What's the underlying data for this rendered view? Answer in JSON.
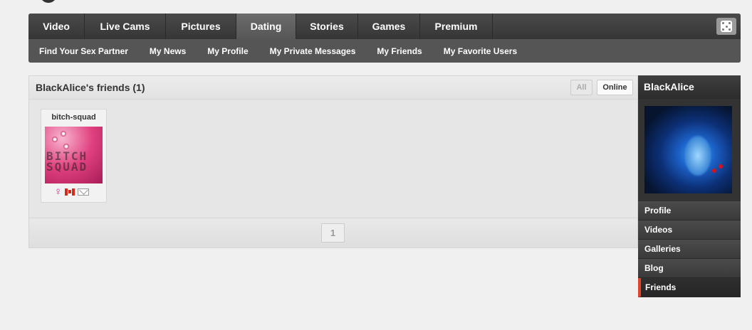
{
  "nav": {
    "tabs": [
      {
        "label": "Video"
      },
      {
        "label": "Live Cams"
      },
      {
        "label": "Pictures"
      },
      {
        "label": "Dating"
      },
      {
        "label": "Stories"
      },
      {
        "label": "Games"
      },
      {
        "label": "Premium"
      }
    ],
    "active_tab": "Dating",
    "sub_items": [
      {
        "label": "Find Your Sex Partner"
      },
      {
        "label": "My News"
      },
      {
        "label": "My Profile"
      },
      {
        "label": "My Private Messages"
      },
      {
        "label": "My Friends"
      },
      {
        "label": "My Favorite Users"
      }
    ],
    "random_icon": "dice-icon"
  },
  "friends_panel": {
    "title": "BlackAlice's friends (1)",
    "filter_all": "All",
    "filter_online": "Online",
    "friends": [
      {
        "username": "bitch-squad",
        "avatar_text": "BITCH SQUAD",
        "gender_icon": "female-icon",
        "country_icon": "canada-flag-icon",
        "message_icon": "mail-icon"
      }
    ],
    "pagination": {
      "current_page": "1"
    }
  },
  "sidebar": {
    "username": "BlackAlice",
    "menu": [
      {
        "label": "Profile"
      },
      {
        "label": "Videos"
      },
      {
        "label": "Galleries"
      },
      {
        "label": "Blog"
      },
      {
        "label": "Friends"
      }
    ],
    "active_item": "Friends"
  },
  "colors": {
    "accent": "#e0452c",
    "female": "#e0208f",
    "nav_dark": "#3c3c3c"
  }
}
